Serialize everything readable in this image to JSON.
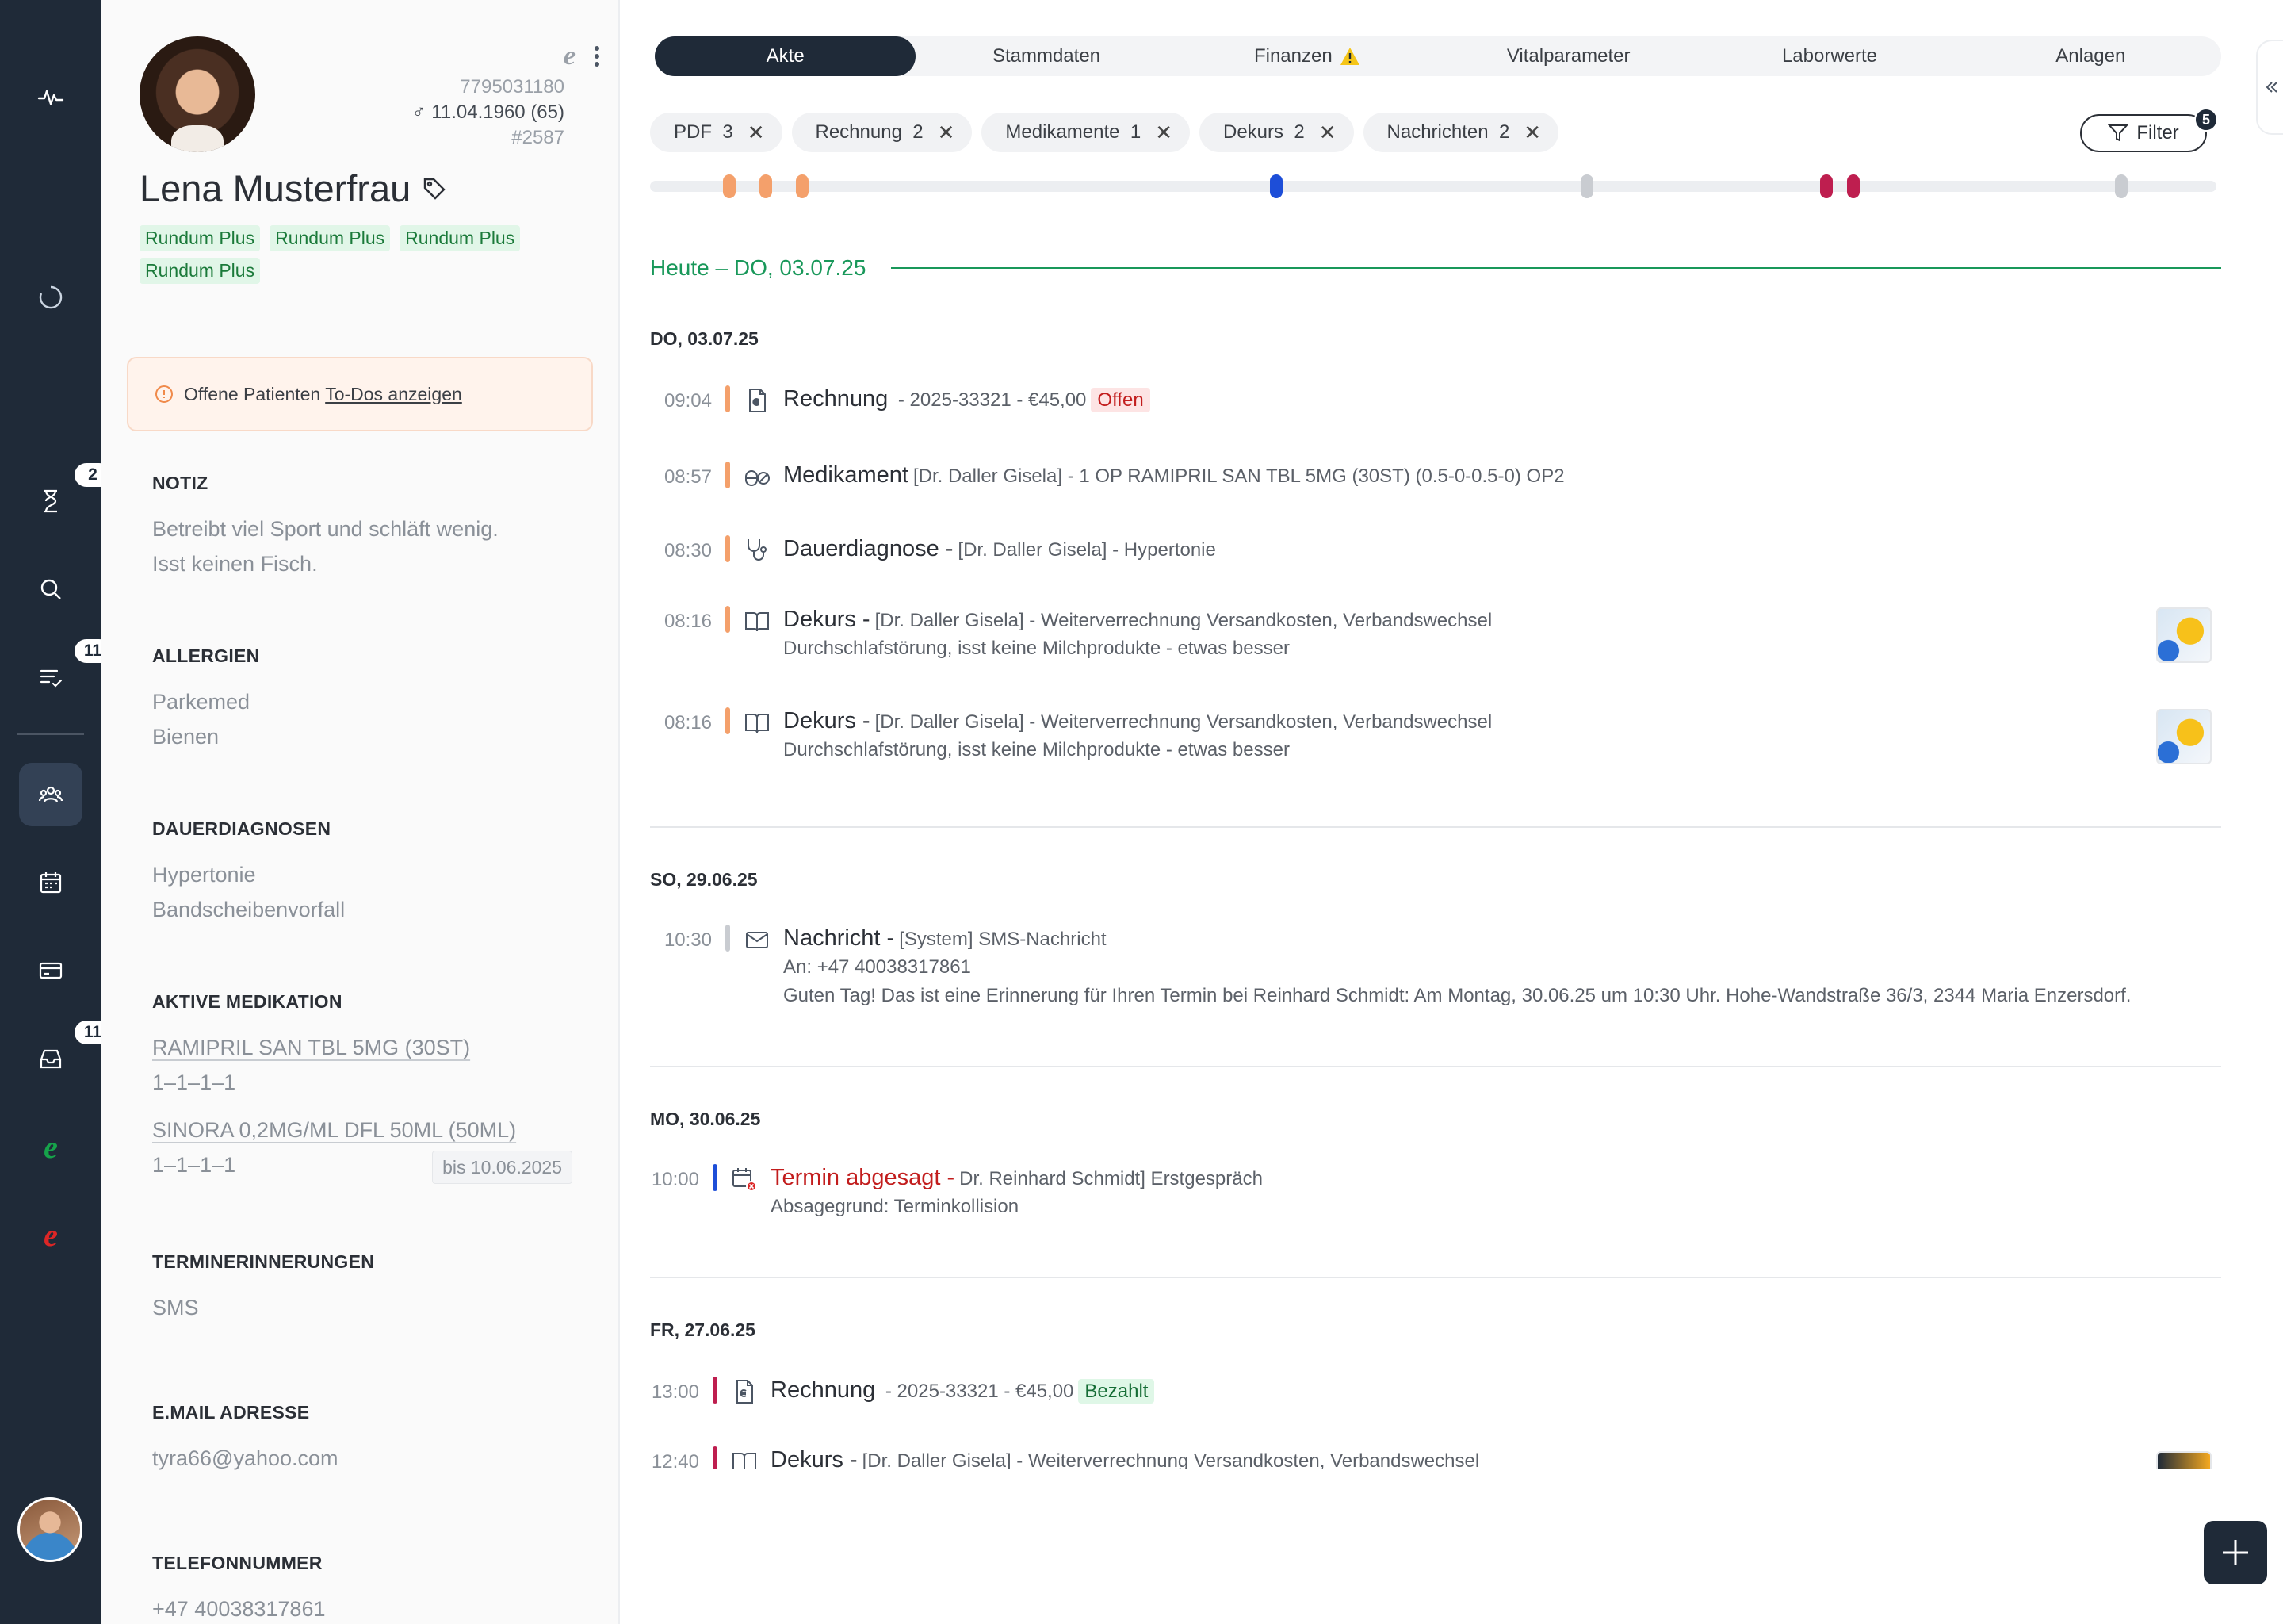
{
  "rail": {
    "badges": {
      "hourglass": "2",
      "tasks": "11",
      "inbox": "11"
    }
  },
  "patient": {
    "name": "Lena Musterfrau",
    "svnr": "7795031180",
    "dob": "♂ 11.04.1960 (65)",
    "id": "#2587",
    "tags": [
      "Rundum Plus",
      "Rundum Plus",
      "Rundum Plus",
      "Rundum Plus"
    ],
    "todo_text": "Offene Patienten ",
    "todo_link": "To-Dos anzeigen",
    "notiz": {
      "title": "NOTIZ",
      "lines": [
        "Betreibt viel Sport und schläft wenig.",
        "Isst keinen Fisch."
      ]
    },
    "allergien": {
      "title": "ALLERGIEN",
      "lines": [
        "Parkemed",
        "Bienen"
      ]
    },
    "dauerdiagnosen": {
      "title": "DAUERDIAGNOSEN",
      "lines": [
        "Hypertonie",
        "Bandscheibenvorfall"
      ]
    },
    "medikation": {
      "title": "AKTIVE MEDIKATION",
      "items": [
        {
          "name": "RAMIPRIL SAN TBL 5MG (30ST)",
          "dose": "1–1–1–1",
          "until": ""
        },
        {
          "name": "SINORA 0,2MG/ML DFL 50ML (50ML)",
          "dose": "1–1–1–1",
          "until": "bis 10.06.2025"
        }
      ]
    },
    "termin": {
      "title": "TERMINERINNERUNGEN",
      "value": "SMS"
    },
    "email": {
      "title": "E.MAIL ADRESSE",
      "value": "tyra66@yahoo.com"
    },
    "telefon": {
      "title": "TELEFONNUMMER",
      "value": "+47 40038317861"
    }
  },
  "tabs": [
    "Akte",
    "Stammdaten",
    "Finanzen",
    "Vitalparameter",
    "Laborwerte",
    "Anlagen"
  ],
  "chips": [
    {
      "label": "PDF",
      "count": "3"
    },
    {
      "label": "Rechnung",
      "count": "2"
    },
    {
      "label": "Medikamente",
      "count": "1"
    },
    {
      "label": "Dekurs",
      "count": "2"
    },
    {
      "label": "Nachrichten",
      "count": "2"
    }
  ],
  "filter": {
    "label": "Filter",
    "count": "5"
  },
  "today": "Heute – DO, 03.07.25",
  "days": [
    {
      "date": "DO, 03.07.25",
      "entries": [
        {
          "time": "09:04",
          "type": "Rechnung",
          "text": " - 2025-33321 - €45,00",
          "status": "Offen"
        },
        {
          "time": "08:57",
          "type": "Medikament",
          "text": "[Dr. Daller Gisela] - 1 OP RAMIPRIL SAN TBL 5MG (30ST) (0.5-0-0.5-0) OP2"
        },
        {
          "time": "08:30",
          "type": "Dauerdiagnose -",
          "text": "[Dr. Daller Gisela] - Hypertonie"
        },
        {
          "time": "08:16",
          "type": "Dekurs -",
          "text": "[Dr. Daller Gisela] - Weiterverrechnung Versandkosten, Verbandswechsel",
          "line2": "Durchschlafstörung, isst keine Milchprodukte - etwas besser"
        },
        {
          "time": "08:16",
          "type": "Dekurs -",
          "text": "[Dr. Daller Gisela] - Weiterverrechnung Versandkosten, Verbandswechsel",
          "line2": "Durchschlafstörung, isst keine Milchprodukte - etwas besser"
        }
      ]
    },
    {
      "date": "SO, 29.06.25",
      "entries": [
        {
          "time": "10:30",
          "type": "Nachricht -",
          "text": "[System] SMS-Nachricht",
          "line2": "An: +47 40038317861",
          "line3": "Guten Tag! Das ist eine Erinnerung für Ihren Termin bei Reinhard Schmidt: Am Montag, 30.06.25 um 10:30 Uhr. Hohe-Wandstraße 36/3, 2344 Maria Enzersdorf."
        }
      ]
    },
    {
      "date": "MO, 30.06.25",
      "entries": [
        {
          "time": "10:00",
          "type": "Termin abgesagt -",
          "text": "Dr. Reinhard Schmidt] Erstgespräch",
          "line2": "Absagegrund: Terminkollision"
        }
      ]
    },
    {
      "date": "FR, 27.06.25",
      "entries": [
        {
          "time": "13:00",
          "type": "Rechnung",
          "text": " - 2025-33321 - €45,00",
          "status": "Bezahlt"
        },
        {
          "time": "12:40",
          "type": "Dekurs -",
          "text": "[Dr. Daller Gisela] - Weiterverrechnung Versandkosten, Verbandswechsel"
        }
      ]
    }
  ],
  "colors": {
    "rail": "#1f2a38",
    "accent_green": "#19985a",
    "orange": "#f4a06b",
    "blue": "#1d4ed8",
    "crimson": "#be1e4f",
    "grey": "#c9ccd1"
  }
}
